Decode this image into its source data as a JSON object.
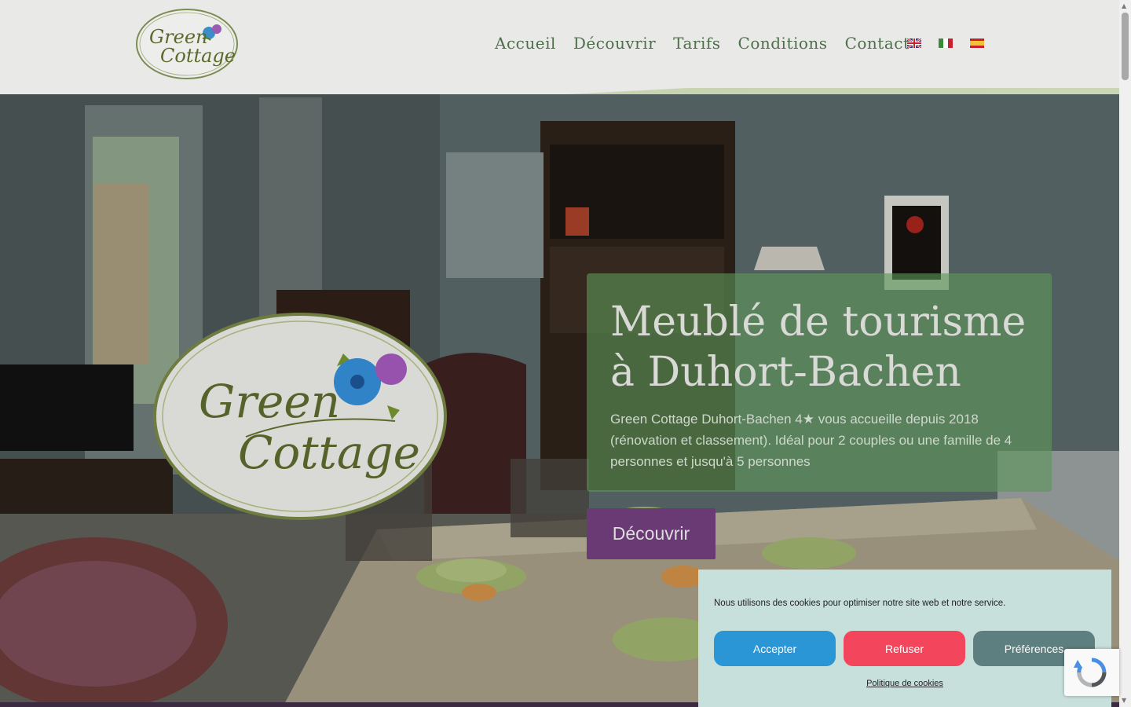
{
  "header": {
    "logo_line1": "Green",
    "logo_line2": "Cottage",
    "nav": [
      {
        "label": "Accueil"
      },
      {
        "label": "Découvrir"
      },
      {
        "label": "Tarifs"
      },
      {
        "label": "Conditions"
      },
      {
        "label": "Contact"
      }
    ],
    "flags": [
      "english-flag-icon",
      "italian-flag-icon",
      "spanish-flag-icon"
    ]
  },
  "hero": {
    "title": "Meublé de tourisme à Duhort-Bachen",
    "text": "Green Cottage Duhort-Bachen 4★ vous accueille depuis 2018 (rénovation et classement). Idéal pour 2 couples ou une famille de 4 personnes et jusqu'à 5 personnes",
    "button_label": "Découvrir",
    "logo_line1": "Green",
    "logo_line2": "Cottage"
  },
  "cookie_banner": {
    "message": "Nous utilisons des cookies pour optimiser notre site web et notre service.",
    "accept_label": "Accepter",
    "refuse_label": "Refuser",
    "preferences_label": "Préférences",
    "policy_link": "Politique de cookies"
  },
  "colors": {
    "nav_text": "#4f6f4c",
    "hero_card": "#5c9658",
    "hero_button": "#6a3a74",
    "accept": "#2b96d6",
    "refuse": "#f3465d",
    "preferences": "#5e7f7f",
    "cookie_bg": "#c8e0dc"
  }
}
